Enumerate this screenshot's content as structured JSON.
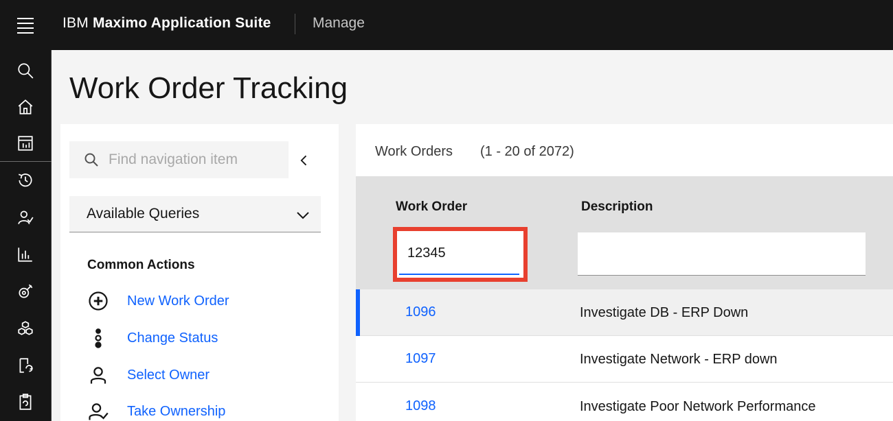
{
  "header": {
    "brand_prefix": "IBM",
    "brand_name": "Maximo Application Suite",
    "app_name": "Manage"
  },
  "rail": {
    "icons": [
      "search-icon",
      "home-icon",
      "dashboard-icon",
      "history-icon",
      "user-check-icon",
      "analytics-icon",
      "asset-icon",
      "structure-icon",
      "refresh-report-icon",
      "clipboard-icon"
    ]
  },
  "page": {
    "title": "Work Order Tracking"
  },
  "nav": {
    "search_placeholder": "Find navigation item",
    "queries_label": "Available Queries",
    "actions_title": "Common Actions",
    "actions": [
      {
        "label": "New Work Order",
        "icon": "add-circle-icon"
      },
      {
        "label": "Change Status",
        "icon": "status-dots-icon"
      },
      {
        "label": "Select Owner",
        "icon": "user-icon"
      },
      {
        "label": "Take Ownership",
        "icon": "user-check-icon"
      }
    ]
  },
  "list": {
    "title": "Work Orders",
    "count": "(1 - 20 of 2072)",
    "columns": [
      "Work Order",
      "Description"
    ],
    "filters": {
      "work_order_value": "12345",
      "description_value": ""
    },
    "rows": [
      {
        "work_order": "1096",
        "description": "Investigate DB - ERP Down"
      },
      {
        "work_order": "1097",
        "description": "Investigate Network - ERP down"
      },
      {
        "work_order": "1098",
        "description": "Investigate Poor Network Performance"
      }
    ]
  },
  "colors": {
    "accent": "#0f62fe",
    "highlight_box": "#e8402f",
    "header_bg": "#161616"
  }
}
